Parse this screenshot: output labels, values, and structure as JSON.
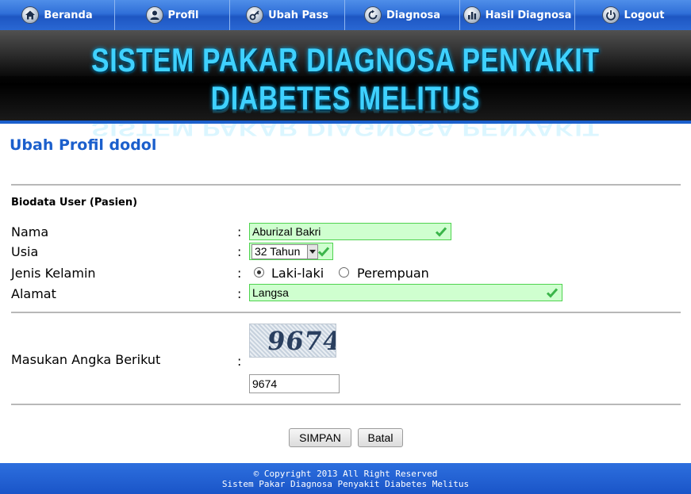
{
  "nav": {
    "items": [
      {
        "label": "Beranda",
        "icon": "home-icon"
      },
      {
        "label": "Profil",
        "icon": "user-icon"
      },
      {
        "label": "Ubah Pass",
        "icon": "key-icon"
      },
      {
        "label": "Diagnosa",
        "icon": "refresh-icon"
      },
      {
        "label": "Hasil Diagnosa",
        "icon": "bar-chart-icon"
      },
      {
        "label": "Logout",
        "icon": "power-icon"
      }
    ]
  },
  "banner": {
    "title": "SISTEM PAKAR DIAGNOSA PENYAKIT DIABETES MELITUS"
  },
  "page": {
    "title": "Ubah Profil dodol"
  },
  "form": {
    "section_title": "Biodata User (Pasien)",
    "colon": ":",
    "nama": {
      "label": "Nama",
      "value": "Aburizal Bakri"
    },
    "usia": {
      "label": "Usia",
      "value": "32 Tahun"
    },
    "jenis_kelamin": {
      "label": "Jenis Kelamin",
      "options": [
        "Laki-laki",
        "Perempuan"
      ],
      "selected": "Laki-laki"
    },
    "alamat": {
      "label": "Alamat",
      "value": "Langsa"
    },
    "captcha": {
      "label": "Masukan Angka Berikut",
      "image_text": "9674",
      "value": "9674"
    }
  },
  "buttons": {
    "save": "SIMPAN",
    "cancel": "Batal"
  },
  "footer": {
    "line1": "© Copyright 2013 All Right Reserved",
    "line2": "Sistem Pakar Diagnosa Penyakit Diabetes Melitus"
  },
  "colors": {
    "nav": "#2f6fd8",
    "title": "#1b5fcc",
    "valid_bg": "#cfffcf",
    "valid_border": "#4fd34f"
  }
}
